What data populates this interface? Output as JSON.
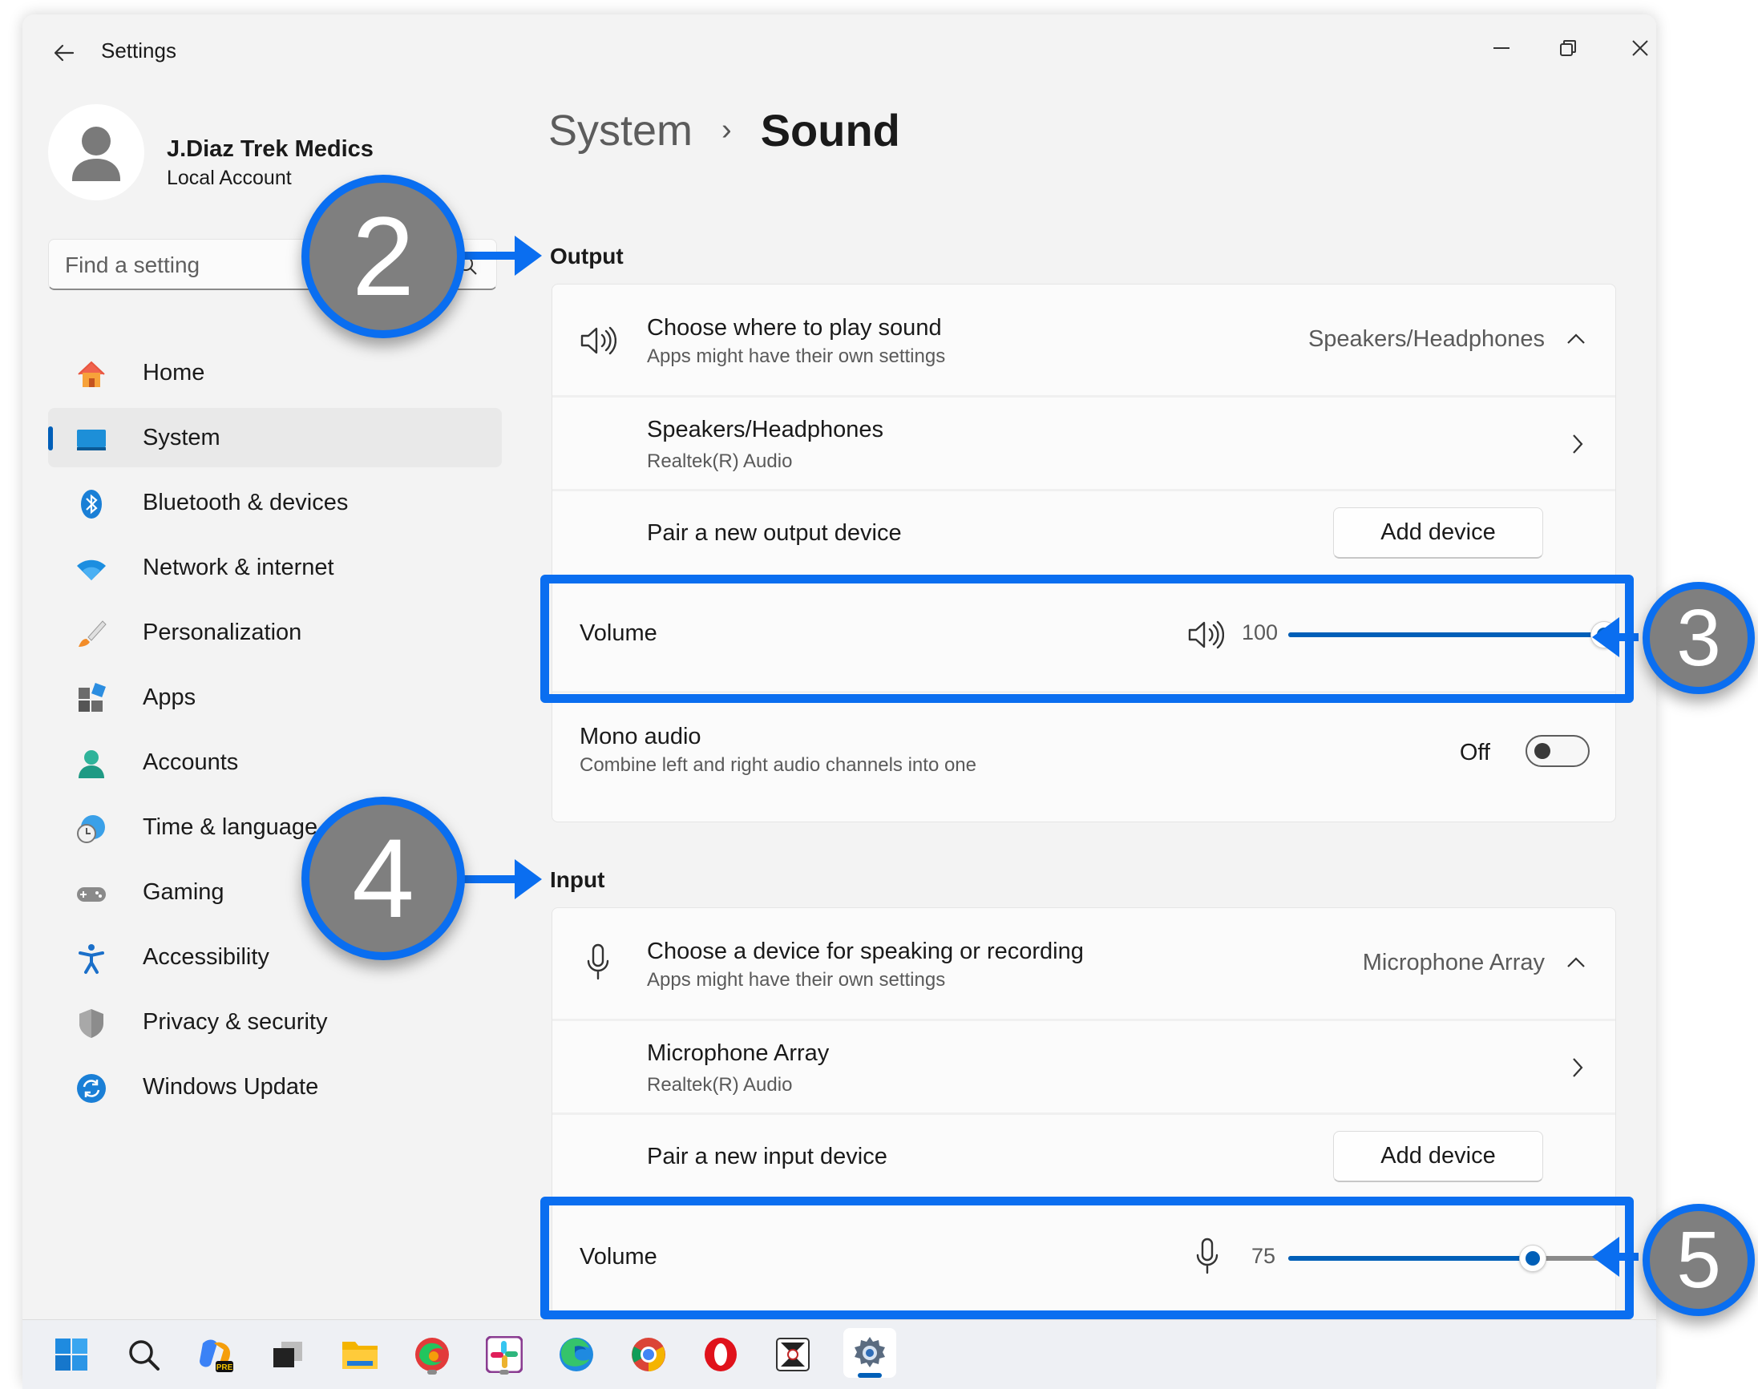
{
  "window": {
    "app_title": "Settings",
    "controls": [
      "minimize-icon",
      "restore-icon",
      "close-icon"
    ]
  },
  "profile": {
    "name": "J.Diaz Trek Medics",
    "account_type": "Local Account"
  },
  "search": {
    "placeholder": "Find a setting"
  },
  "sidebar": {
    "items": [
      {
        "label": "Home",
        "icon": "home-icon"
      },
      {
        "label": "System",
        "icon": "system-icon",
        "active": true
      },
      {
        "label": "Bluetooth & devices",
        "icon": "bluetooth-icon"
      },
      {
        "label": "Network & internet",
        "icon": "wifi-icon"
      },
      {
        "label": "Personalization",
        "icon": "brush-icon"
      },
      {
        "label": "Apps",
        "icon": "apps-icon"
      },
      {
        "label": "Accounts",
        "icon": "person-icon"
      },
      {
        "label": "Time & language",
        "icon": "globe-clock-icon"
      },
      {
        "label": "Gaming",
        "icon": "gamepad-icon"
      },
      {
        "label": "Accessibility",
        "icon": "accessibility-icon"
      },
      {
        "label": "Privacy & security",
        "icon": "shield-icon"
      },
      {
        "label": "Windows Update",
        "icon": "update-icon"
      }
    ]
  },
  "breadcrumb": {
    "parent": "System",
    "separator": "›",
    "current": "Sound"
  },
  "output": {
    "section_title": "Output",
    "choose_title": "Choose where to play sound",
    "choose_sub": "Apps might have their own settings",
    "choose_value": "Speakers/Headphones",
    "device_name": "Speakers/Headphones",
    "device_sub": "Realtek(R) Audio",
    "pair_label": "Pair a new output device",
    "add_button": "Add device",
    "volume_label": "Volume",
    "volume_value": "100",
    "volume_fraction": 1.0,
    "mono_title": "Mono audio",
    "mono_sub": "Combine left and right audio channels into one",
    "mono_state": "Off"
  },
  "input": {
    "section_title": "Input",
    "choose_title": "Choose a device for speaking or recording",
    "choose_sub": "Apps might have their own settings",
    "choose_value": "Microphone Array",
    "device_name": "Microphone Array",
    "device_sub": "Realtek(R) Audio",
    "pair_label": "Pair a new input device",
    "add_button": "Add device",
    "volume_label": "Volume",
    "volume_value": "75",
    "volume_fraction": 0.75
  },
  "callouts": [
    "2",
    "3",
    "4",
    "5"
  ],
  "colors": {
    "accent": "#005fb8",
    "callout_border": "#0a6ef0",
    "callout_fill": "#7f7f7f"
  },
  "taskbar": {
    "icons": [
      "windows-start-icon",
      "search-icon",
      "copilot-icon",
      "task-view-icon",
      "file-explorer-icon",
      "edge-canary-icon",
      "slack-icon",
      "edge-icon",
      "chrome-icon",
      "opera-icon",
      "app-icon",
      "settings-icon"
    ]
  }
}
